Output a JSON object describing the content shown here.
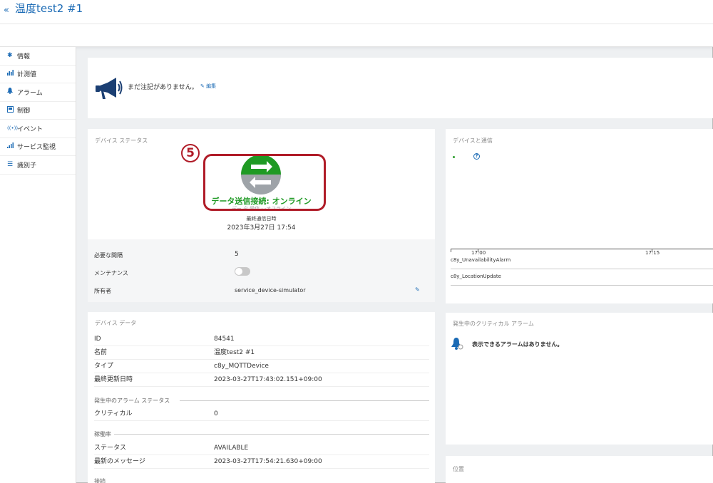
{
  "header": {
    "back_glyph": "«",
    "title": "温度test2 #1"
  },
  "sidebar": {
    "items": [
      {
        "icon": "asterisk-icon",
        "glyph": "✱",
        "label": "情報"
      },
      {
        "icon": "chart-icon",
        "glyph": "📊",
        "label": "計測値"
      },
      {
        "icon": "bell-icon",
        "glyph": "🔔",
        "label": "アラーム"
      },
      {
        "icon": "control-icon",
        "glyph": "▣",
        "label": "制御"
      },
      {
        "icon": "broadcast-icon",
        "glyph": "((•))",
        "label": "イベント"
      },
      {
        "icon": "signal-icon",
        "glyph": ".ıl",
        "label": "サービス監視"
      },
      {
        "icon": "list-icon",
        "glyph": "☰",
        "label": "識別子"
      }
    ]
  },
  "notes": {
    "text": "まだ注記がありません。",
    "edit_label": "編集"
  },
  "status_card": {
    "title": "デバイス ステータス",
    "connection_label": "データ送信接続: オンライン",
    "ghost_text": "デー タ 受信 · ·オフライン",
    "last_comm_label": "最終通信日時",
    "last_comm_value": "2023年3月27日 17:54"
  },
  "annotation": {
    "number": "5"
  },
  "properties": [
    {
      "label": "必要な間隔",
      "value": "5"
    },
    {
      "label": "メンテナンス",
      "value": ""
    },
    {
      "label": "所有者",
      "value": "service_device-simulator"
    }
  ],
  "device_data": {
    "title": "デバイス データ",
    "rows": [
      {
        "label": "ID",
        "value": "84541"
      },
      {
        "label": "名前",
        "value": "温度test2 #1"
      },
      {
        "label": "タイプ",
        "value": "c8y_MQTTDevice"
      },
      {
        "label": "最終更新日時",
        "value": "2023-03-27T17:43:02.151+09:00"
      }
    ],
    "alarm_section": "発生中のアラーム ステータス",
    "alarm_rows": [
      {
        "label": "クリティカル",
        "value": "0"
      }
    ],
    "availability_section": "稼働率",
    "availability_rows": [
      {
        "label": "ステータス",
        "value": "AVAILABLE"
      },
      {
        "label": "最新のメッセージ",
        "value": "2023-03-27T17:54:21.630+09:00"
      }
    ],
    "next_section": "接続"
  },
  "communication": {
    "title": "デバイスと通信",
    "help_glyph": "?",
    "ticks": [
      "17:00",
      "17:15"
    ],
    "events": [
      "c8y_UnavailabilityAlarm",
      "c8y_LocationUpdate"
    ]
  },
  "alarms": {
    "title": "発生中のクリティカル アラーム",
    "empty": "表示できるアラームはありません。"
  },
  "location": {
    "title": "位置"
  },
  "colors": {
    "accent": "#1c6bb5",
    "online": "#1f9a24",
    "annotation": "#b01c28"
  }
}
